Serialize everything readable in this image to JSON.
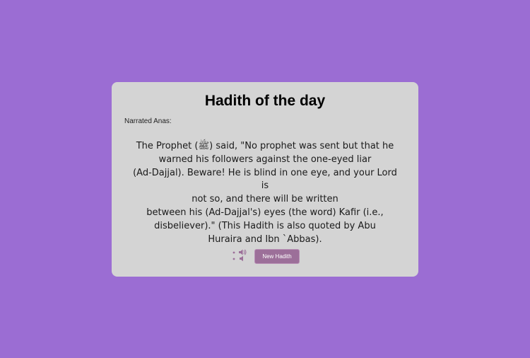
{
  "card": {
    "title": "Hadith of the day",
    "narrator": "Narrated Anas:",
    "text": "The Prophet (ﷺ) said, \"No prophet was sent but that he\nwarned his followers against the one-eyed liar\n(Ad-Dajjal). Beware! He is blind in one eye, and your Lord is\nnot so, and there will be written\nbetween his (Ad-Dajjal's) eyes (the word) Kafir (i.e.,\ndisbeliever).\" (This Hadith is also quoted by Abu\nHuraira and Ibn `Abbas).",
    "speaker_icon": "speaker-icon",
    "new_button_label": "New Hadith"
  },
  "colors": {
    "background": "#9b6dd3",
    "card": "#d4d4d4",
    "accent": "#9c6f99"
  }
}
